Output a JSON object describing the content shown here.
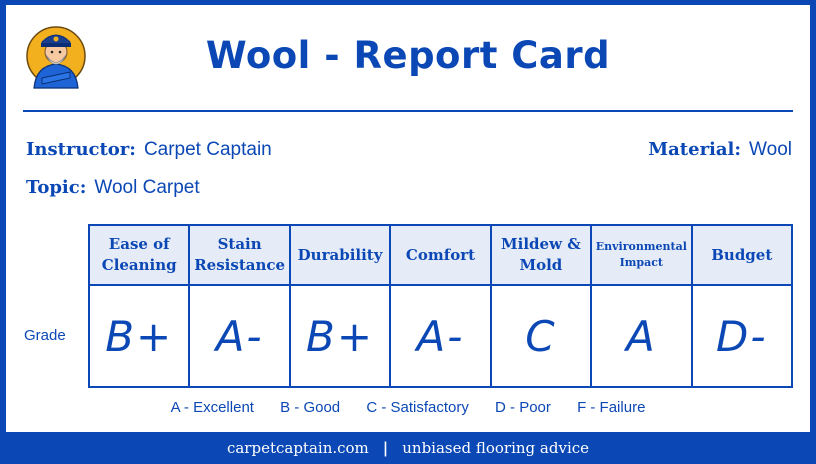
{
  "title": "Wool - Report Card",
  "instructor": {
    "label": "Instructor:",
    "value": "Carpet Captain"
  },
  "topic": {
    "label": "Topic:",
    "value": "Wool Carpet"
  },
  "material": {
    "label": "Material:",
    "value": "Wool"
  },
  "row_label": "Grade",
  "columns": [
    {
      "header": "Ease of Cleaning",
      "grade": "B+"
    },
    {
      "header": "Stain Resistance",
      "grade": "A-"
    },
    {
      "header": "Durability",
      "grade": "B+"
    },
    {
      "header": "Comfort",
      "grade": "A-"
    },
    {
      "header": "Mildew & Mold",
      "grade": "C"
    },
    {
      "header": "Environmental Impact",
      "grade": "A"
    },
    {
      "header": "Budget",
      "grade": "D-"
    }
  ],
  "legend": [
    "A - Excellent",
    "B - Good",
    "C - Satisfactory",
    "D - Poor",
    "F - Failure"
  ],
  "footer": {
    "site": "carpetcaptain.com",
    "separator": "|",
    "tagline": "unbiased flooring advice"
  },
  "colors": {
    "brand": "#0b48b5",
    "header_fill": "#e6ecf7",
    "logo_gold": "#f2b01e"
  },
  "logo_icon": "captain-mascot-icon"
}
